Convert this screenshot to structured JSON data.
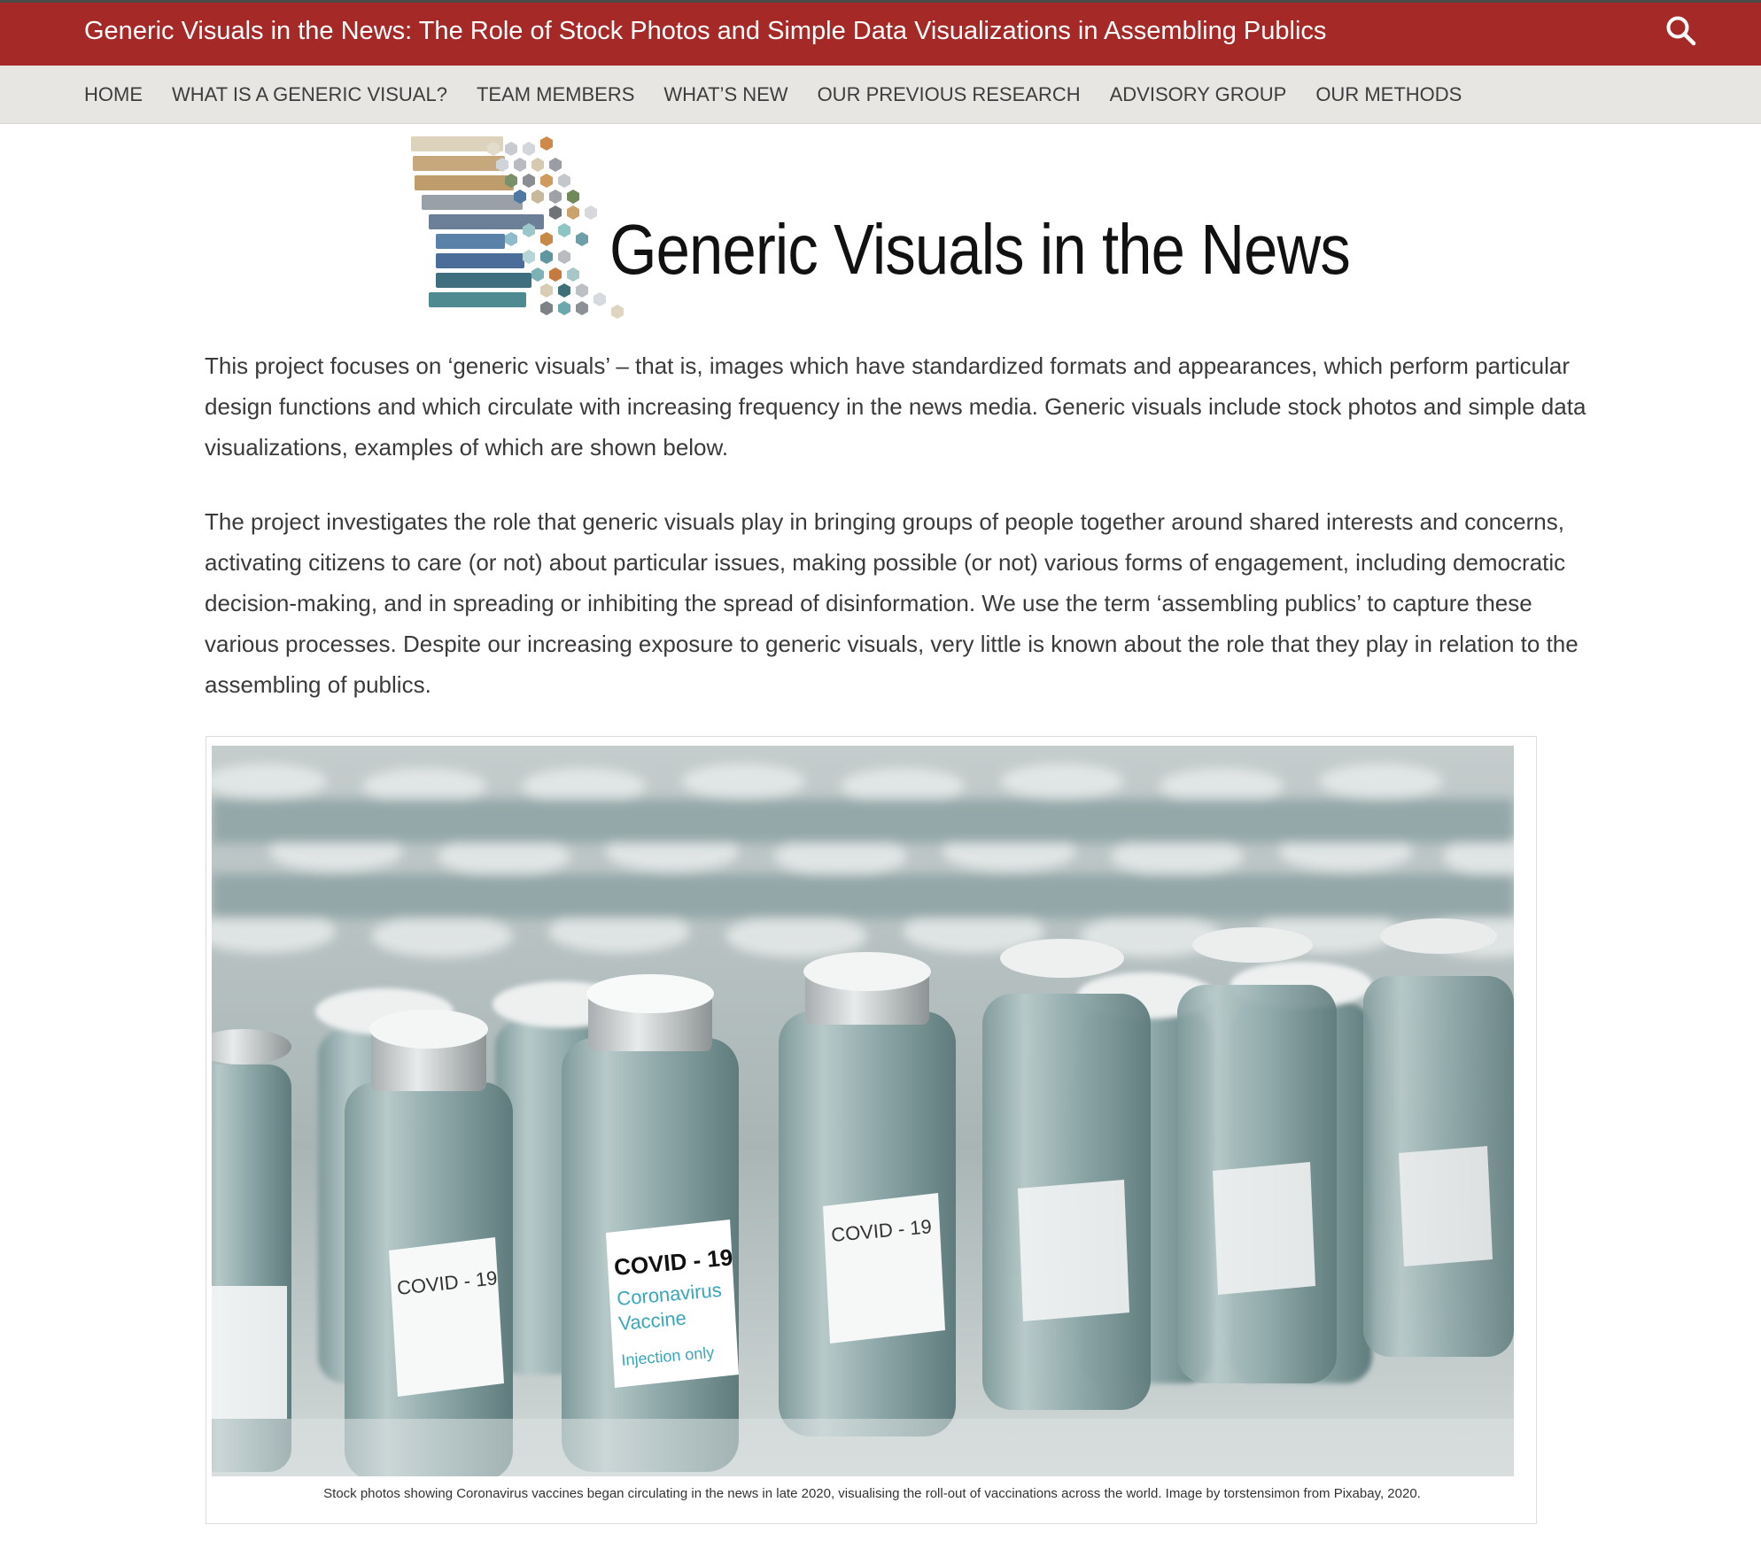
{
  "header": {
    "site_title": "Generic Visuals in the News: The Role of Stock Photos and Simple Data Visualizations in Assembling Publics",
    "search_icon": "search-icon",
    "background": "#a52a27"
  },
  "nav": {
    "items": [
      {
        "label": "HOME"
      },
      {
        "label": "WHAT IS A GENERIC VISUAL?"
      },
      {
        "label": "TEAM MEMBERS"
      },
      {
        "label": "WHAT’S NEW"
      },
      {
        "label": "OUR PREVIOUS RESEARCH"
      },
      {
        "label": "ADVISORY GROUP"
      },
      {
        "label": "OUR METHODS"
      }
    ]
  },
  "logo": {
    "text": "Generic Visuals in the News"
  },
  "content": {
    "paragraph_1": "This project focuses on ‘generic visuals’ – that is, images which have standardized formats and appearances, which perform particular design functions and which circulate with increasing frequency in the news media. Generic visuals include stock photos and simple data visualizations, examples of which are shown below.",
    "paragraph_2": "The project investigates the role that generic visuals play in bringing groups of people together around shared interests and concerns, activating citizens to care (or not) about particular issues, making possible (or not) various forms of engagement, including democratic decision-making, and in spreading or inhibiting the spread of disinformation. We use the term ‘assembling publics’ to capture these various processes. Despite our increasing exposure to generic visuals, very little is known about the role that they play in relation to the assembling of publics."
  },
  "figure": {
    "vial_label": {
      "line1": "COVID - 19",
      "line2": "Coronavirus",
      "line3": "Vaccine",
      "line4": "Injection only"
    },
    "caption": "Stock photos showing Coronavirus vaccines began circulating in the news in late 2020, visualising the roll-out of vaccinations across the world.  Image by torstensimon from Pixabay, 2020."
  }
}
